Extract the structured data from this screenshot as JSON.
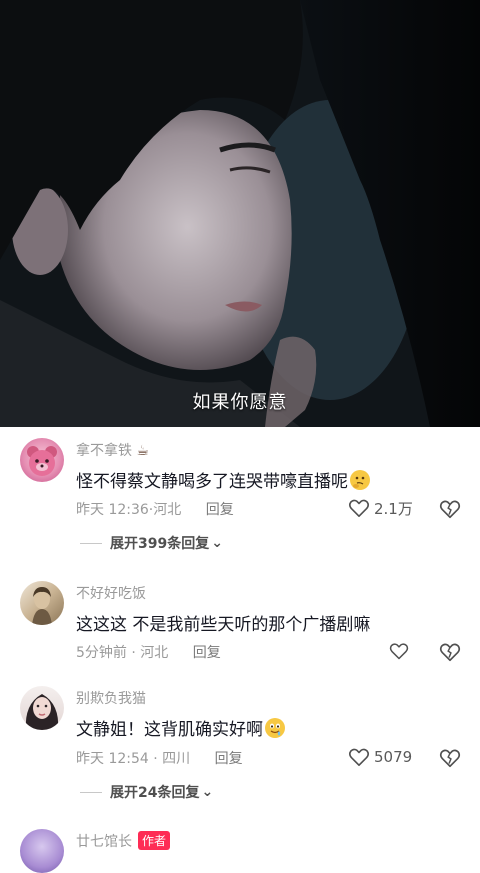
{
  "video": {
    "subtitle": "如果你愿意"
  },
  "comments": [
    {
      "username": "拿不拿铁",
      "user_emoji": "☕",
      "text": "怪不得蔡文静喝多了连哭带嚎直播呢",
      "text_emoji": "thinking-emoji",
      "time": "昨天 12:36",
      "location": "河北",
      "reply_label": "回复",
      "likes": "2.1万",
      "expand": "展开399条回复"
    },
    {
      "username": "不好好吃饭",
      "text": "这这这   不是我前些天听的那个广播剧嘛",
      "time": "5分钟前",
      "location": "河北",
      "reply_label": "回复",
      "likes": ""
    },
    {
      "username": "别欺负我猫",
      "text": "文静姐！这背肌确实好啊",
      "text_emoji": "drooling-emoji",
      "time": "昨天 12:54",
      "location": "四川",
      "reply_label": "回复",
      "likes": "5079",
      "expand": "展开24条回复"
    },
    {
      "username": "廿七馆长",
      "badge": "作者"
    }
  ],
  "colors": {
    "accent": "#fe2c55",
    "text_primary": "#161823",
    "text_secondary": "#9a9a9a"
  }
}
